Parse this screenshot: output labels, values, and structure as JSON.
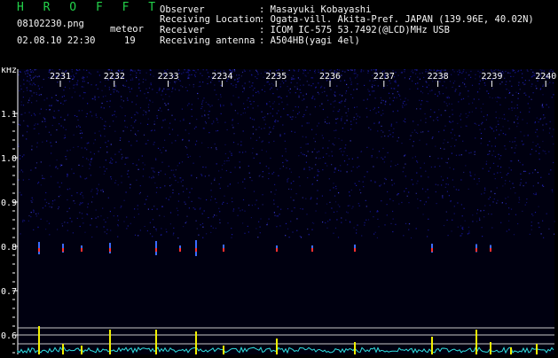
{
  "header": {
    "brand": "H R O F F T",
    "filename": "08102230.png",
    "datetime": "02.08.10 22:30",
    "meteor_label": "meteor",
    "meteor_count": "19",
    "fields": [
      {
        "label": "Observer",
        "value": ": Masayuki Kobayashi"
      },
      {
        "label": "Receiving Location",
        "value": ": Ogata-vill. Akita-Pref. JAPAN (139.96E, 40.02N)"
      },
      {
        "label": "Receiver",
        "value": ": ICOM IC-575 53.7492(@LCD)MHz USB"
      },
      {
        "label": "Receiving antenna",
        "value": ": A504HB(yagi 4el)"
      }
    ]
  },
  "spectrogram": {
    "y_unit": "kHz",
    "y_ticks": [
      "1.1",
      "1.0",
      "0.9",
      "0.8",
      "0.7",
      "0.6"
    ],
    "time_ticks": [
      "2231",
      "2232",
      "2233",
      "2234",
      "2235",
      "2236",
      "2237",
      "2238",
      "2239",
      "2240"
    ],
    "colors": {
      "background": "#000010",
      "noise": "#1a1aa8",
      "echo": "#ff3030",
      "trace_cyan": "#30e0e0",
      "trace_yellow": "#f0f000",
      "border": "#ffffff"
    }
  }
}
